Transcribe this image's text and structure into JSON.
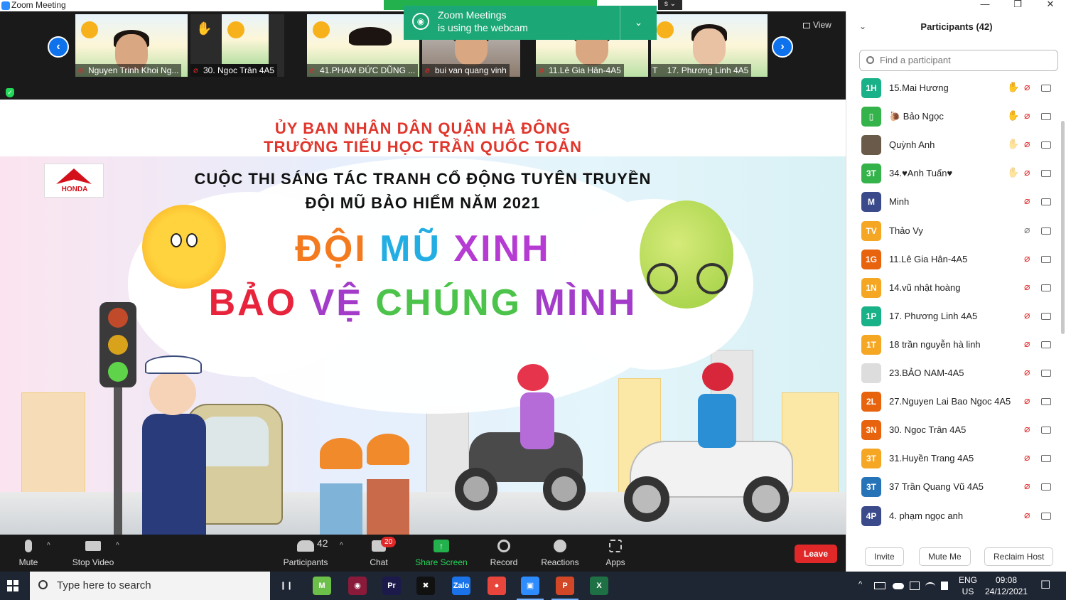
{
  "window": {
    "title": "Zoom Meeting",
    "minimize": "—",
    "maximize": "❐",
    "close": "✕"
  },
  "video_strip": {
    "prev": "‹",
    "next": "›",
    "view_label": "View",
    "tiles": [
      {
        "name": "Nguyen Trinh Khoi Ng..."
      },
      {
        "name": "30. Ngoc Trân 4A5"
      },
      {
        "name": "41.PHAM ĐỨC DŨNG ..."
      },
      {
        "name": "bui van quang vinh"
      },
      {
        "name": "11.Lê Gia Hân-4A5"
      },
      {
        "name": "17. Phương Linh 4A5"
      }
    ],
    "partial_label": "T"
  },
  "notification": {
    "line1": "Zoom Meetings",
    "line2": "is using the webcam",
    "chevron": "⌄"
  },
  "top_tab_fragment": "s ⌄",
  "share": {
    "line1": "ỦY BAN NHÂN DÂN QUẬN HÀ ĐÔNG",
    "line2": "TRƯỜNG TIỂU HỌC TRẦN QUỐC TOẢN",
    "line3": "CUỘC THI SÁNG TÁC TRANH CỔ ĐỘNG TUYÊN TRUYỀN",
    "line4": "ĐỘI MŨ BẢO HIỂM NĂM 2021",
    "big1": [
      "ĐỘI",
      " MŨ",
      " XINH"
    ],
    "big2": [
      "BẢO",
      " VỆ",
      " CHÚNG",
      " MÌNH"
    ],
    "logo": "HONDA"
  },
  "toolbar": {
    "mute": "Mute",
    "stop_video": "Stop Video",
    "participants": "Participants",
    "participants_count": "42",
    "chat": "Chat",
    "chat_badge": "20",
    "share_screen": "Share Screen",
    "record": "Record",
    "reactions": "Reactions",
    "apps": "Apps",
    "leave": "Leave",
    "caret": "^"
  },
  "panel": {
    "collapse": "⌄",
    "title": "Participants (42)",
    "search_placeholder": "Find a participant",
    "participants": [
      {
        "initials": "1H",
        "name": "15.Mai Hương",
        "color": "#19b187",
        "hand": "✋"
      },
      {
        "initials": "▯",
        "name": "🐌 Bảo Ngọc",
        "color": "#33b34a",
        "hand": "✋"
      },
      {
        "initials": "",
        "name": "Quỳnh Anh",
        "color": "#6a5a4a",
        "hand": "✋"
      },
      {
        "initials": "3T",
        "name": "34.♥Anh Tuấn♥",
        "color": "#33b34a",
        "hand": "✋"
      },
      {
        "initials": "M",
        "name": "Minh",
        "color": "#3a4a8a",
        "hand": ""
      },
      {
        "initials": "TV",
        "name": "Thảo Vy",
        "color": "#f5a623",
        "hand": ""
      },
      {
        "initials": "1G",
        "name": "11.Lê Gia Hân-4A5",
        "color": "#e8630e",
        "hand": ""
      },
      {
        "initials": "1N",
        "name": "14.vũ nhật hoàng",
        "color": "#f5a623",
        "hand": ""
      },
      {
        "initials": "1P",
        "name": "17. Phương Linh 4A5",
        "color": "#19b187",
        "hand": ""
      },
      {
        "initials": "1T",
        "name": "18 trần nguyễn hà linh",
        "color": "#f5a623",
        "hand": ""
      },
      {
        "initials": "",
        "name": "23.BẢO NAM-4A5",
        "color": "#dddddd",
        "hand": ""
      },
      {
        "initials": "2L",
        "name": "27.Nguyen Lai Bao Ngoc 4A5",
        "color": "#e8630e",
        "hand": ""
      },
      {
        "initials": "3N",
        "name": "30. Ngoc Trân 4A5",
        "color": "#e8630e",
        "hand": ""
      },
      {
        "initials": "3T",
        "name": "31.Huyền Trang 4A5",
        "color": "#f5a623",
        "hand": ""
      },
      {
        "initials": "3T",
        "name": "37 Trần Quang Vũ 4A5",
        "color": "#2673b8",
        "hand": ""
      },
      {
        "initials": "4P",
        "name": "4. phạm ngọc anh",
        "color": "#3a4a8a",
        "hand": ""
      }
    ],
    "mute_icon": "⌀",
    "invite": "Invite",
    "mute_me": "Mute Me",
    "reclaim_host": "Reclaim Host"
  },
  "taskbar": {
    "search_placeholder": "Type here to search",
    "lang1": "ENG",
    "lang2": "US",
    "time": "09:08",
    "date": "24/12/2021",
    "apps": [
      {
        "name": "task-view",
        "label": "❙❙",
        "color": "#1f2633"
      },
      {
        "name": "mindmap",
        "label": "M",
        "color": "#6cc04a"
      },
      {
        "name": "media",
        "label": "◉",
        "color": "#8a1a3a"
      },
      {
        "name": "premiere",
        "label": "Pr",
        "color": "#1c1a4a"
      },
      {
        "name": "capcut",
        "label": "✖",
        "color": "#111111"
      },
      {
        "name": "zalo",
        "label": "Zalo",
        "color": "#1a73e8"
      },
      {
        "name": "chrome",
        "label": "●",
        "color": "#e8453c"
      },
      {
        "name": "zoom",
        "label": "▣",
        "color": "#2d8cff"
      },
      {
        "name": "powerpoint",
        "label": "P",
        "color": "#d24726"
      },
      {
        "name": "excel",
        "label": "X",
        "color": "#1e7145"
      }
    ],
    "tray_arrow": "^",
    "notif_icon": "☐"
  }
}
